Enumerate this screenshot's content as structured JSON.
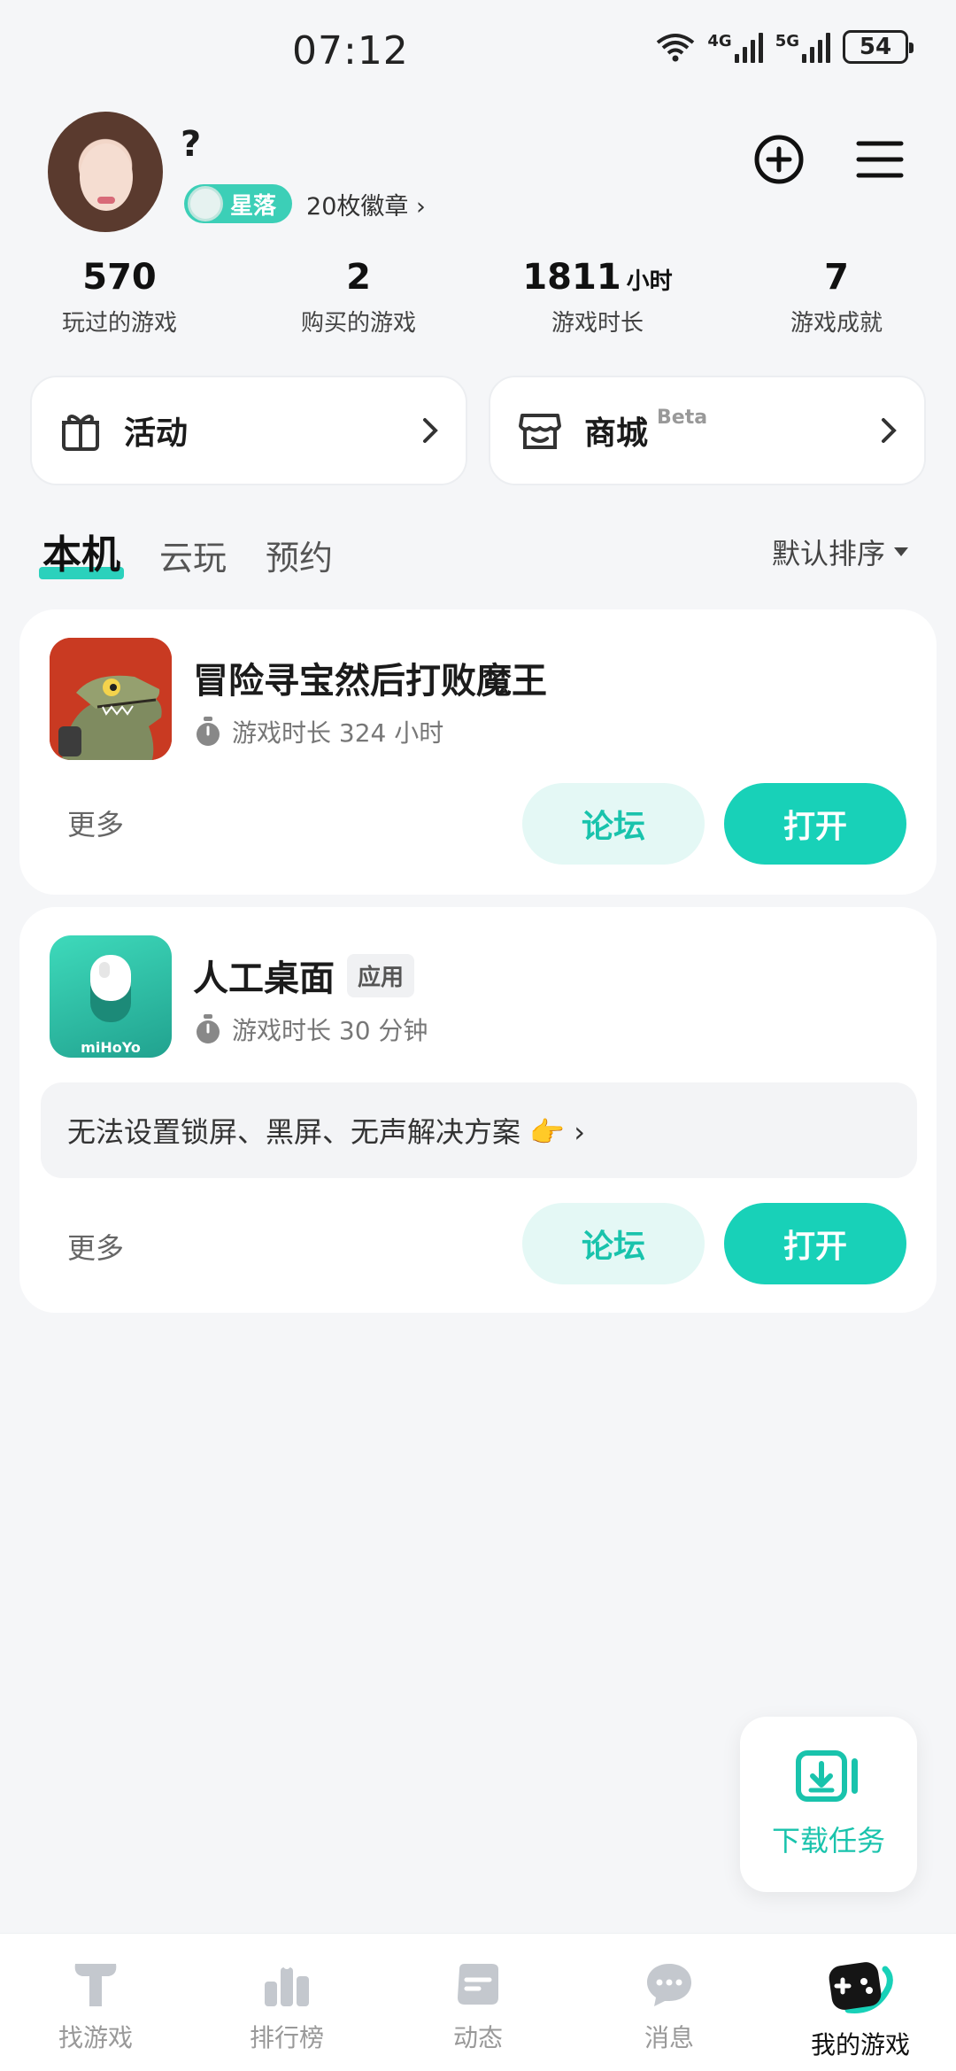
{
  "status_bar": {
    "time": "07:12",
    "net1": "4G",
    "net2": "5G",
    "battery": "54"
  },
  "profile": {
    "name": "?",
    "badge_label": "星落",
    "badge_count": "20枚徽章 ›"
  },
  "stats": [
    {
      "value": "570",
      "unit": "",
      "label": "玩过的游戏"
    },
    {
      "value": "2",
      "unit": "",
      "label": "购买的游戏"
    },
    {
      "value": "1811",
      "unit": "小时",
      "label": "游戏时长"
    },
    {
      "value": "7",
      "unit": "",
      "label": "游戏成就"
    }
  ],
  "quick": {
    "activity": "活动",
    "store": "商城",
    "store_tag": "Beta"
  },
  "tabs": {
    "local": "本机",
    "cloud": "云玩",
    "reserve": "预约"
  },
  "sort_label": "默认排序",
  "games": [
    {
      "name": "冒险寻宝然后打败魔王",
      "tag": "",
      "playtime": "游戏时长 324 小时",
      "more": "更多",
      "forum": "论坛",
      "open": "打开"
    },
    {
      "name": "人工桌面",
      "tag": "应用",
      "playtime": "游戏时长 30 分钟",
      "tip": "无法设置锁屏、黑屏、无声解决方案 👉 ›",
      "more": "更多",
      "forum": "论坛",
      "open": "打开",
      "icon_text": "miHoYo"
    }
  ],
  "download": {
    "label": "下载任务"
  },
  "nav": [
    {
      "label": "找游戏"
    },
    {
      "label": "排行榜"
    },
    {
      "label": "动态"
    },
    {
      "label": "消息"
    },
    {
      "label": "我的游戏"
    }
  ],
  "colors": {
    "accent": "#18d1b8",
    "accent_light": "#e4f8f5",
    "background": "#f5f6f8"
  }
}
